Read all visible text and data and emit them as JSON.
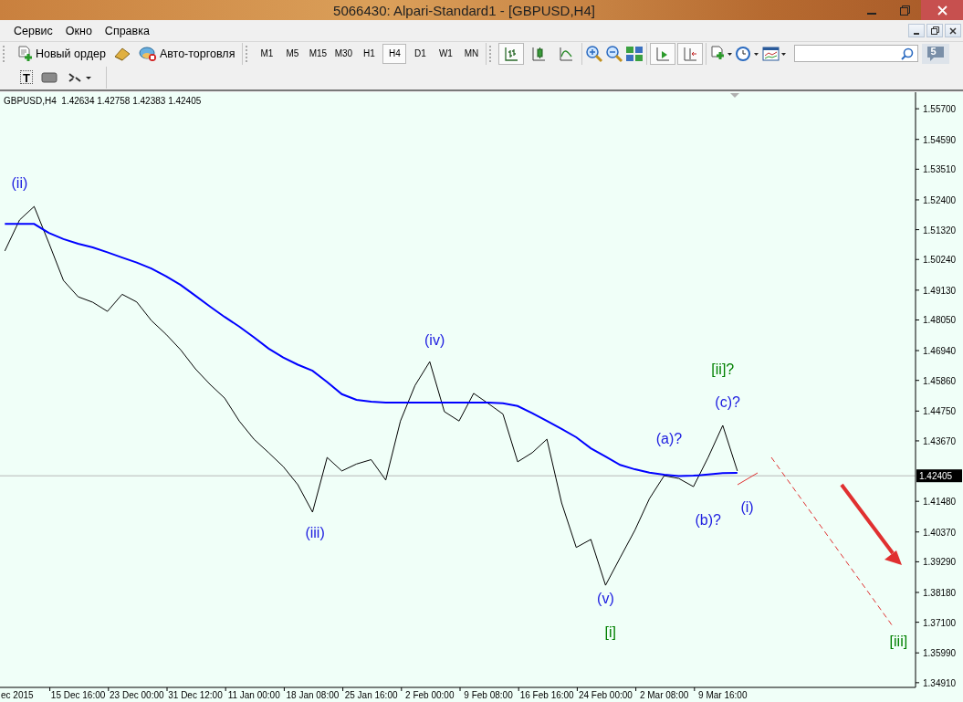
{
  "window": {
    "title": "5066430: Alpari-Standard1 - [GBPUSD,H4]"
  },
  "menu": [
    {
      "label": "Сервис"
    },
    {
      "label": "Окно"
    },
    {
      "label": "Справка"
    }
  ],
  "toolbar": {
    "order_button": "Новый ордер",
    "autotrade_button": "Авто-торговля",
    "timeframes": [
      {
        "label": "M1",
        "selected": false
      },
      {
        "label": "M5",
        "selected": false
      },
      {
        "label": "M15",
        "selected": false
      },
      {
        "label": "M30",
        "selected": false
      },
      {
        "label": "H1",
        "selected": false
      },
      {
        "label": "H4",
        "selected": true
      },
      {
        "label": "D1",
        "selected": false
      },
      {
        "label": "W1",
        "selected": false
      },
      {
        "label": "MN",
        "selected": false
      }
    ],
    "chart_types": [
      {
        "kind": "bars",
        "selected": true
      },
      {
        "kind": "candles",
        "selected": false
      },
      {
        "kind": "line",
        "selected": false
      }
    ],
    "scroll_tools": [
      {
        "kind": "autoscroll",
        "selected": true
      },
      {
        "kind": "shift",
        "selected": true
      }
    ],
    "notification_count": "5"
  },
  "drawing_toolbar": {
    "text_label_tool": "T"
  },
  "chart": {
    "header": "GBPUSD,H4  1.42634 1.42758 1.42383 1.42405",
    "current_price": "1.42405",
    "cut_time_label": "ec 2015",
    "chart_data": {
      "type": "line",
      "categories": [
        null,
        null,
        null,
        null,
        null,
        "15 Dec 16:00",
        null,
        null,
        null,
        "23 Dec 00:00",
        null,
        null,
        null,
        "31 Dec 12:00",
        null,
        null,
        null,
        "11 Jan 00:00",
        null,
        null,
        null,
        "18 Jan 08:00",
        null,
        null,
        null,
        "25 Jan 16:00",
        null,
        null,
        null,
        "2 Feb 00:00",
        null,
        null,
        null,
        "9 Feb 08:00",
        null,
        null,
        null,
        "16 Feb 16:00",
        null,
        null,
        null,
        "24 Feb 00:00",
        null,
        null,
        null,
        "2 Mar 08:00",
        null,
        null,
        null,
        "9 Mar 16:00",
        null
      ],
      "ref_lines": [
        {
          "axis": "y",
          "value": 1.42405,
          "color": "#b8b8b8"
        }
      ],
      "series": [
        {
          "color": "#000000",
          "values": [
            1.5055,
            1.5167,
            1.5216,
            1.5084,
            1.4948,
            1.4889,
            1.4869,
            1.4836,
            1.4898,
            1.487,
            1.4803,
            1.4753,
            1.4697,
            1.4628,
            1.4572,
            1.4522,
            1.4439,
            1.4373,
            1.4324,
            1.4274,
            1.4208,
            1.4109,
            1.4307,
            1.4258,
            1.4283,
            1.4299,
            1.4225,
            1.4439,
            1.4568,
            1.4654,
            1.4473,
            1.4439,
            1.4539,
            1.4502,
            1.4464,
            1.4291,
            1.4324,
            1.4373,
            1.4142,
            1.3981,
            1.401,
            1.3844,
            1.3944,
            1.4043,
            1.4158,
            1.4241,
            1.4231,
            1.4201,
            1.4307,
            1.4423,
            1.4258
          ]
        },
        {
          "color": "#0000ff",
          "values": [
            1.5153,
            1.5153,
            1.5153,
            1.512,
            1.5098,
            1.5081,
            1.5068,
            1.505,
            1.5031,
            1.5013,
            1.4991,
            1.4963,
            1.4932,
            1.4893,
            1.4854,
            1.4816,
            1.4781,
            1.4742,
            1.4701,
            1.4669,
            1.4643,
            1.4621,
            1.458,
            1.4536,
            1.4516,
            1.4509,
            1.4506,
            1.4506,
            1.4506,
            1.4506,
            1.4506,
            1.4506,
            1.4506,
            1.4506,
            1.4503,
            1.4493,
            1.4467,
            1.4439,
            1.441,
            1.438,
            1.434,
            1.431,
            1.428,
            1.4264,
            1.4252,
            1.4244,
            1.424,
            1.4241,
            1.4245,
            1.425,
            1.4251
          ]
        }
      ],
      "ylim": [
        1.3474,
        1.563
      ],
      "yticks": [
        {
          "value": 1.557,
          "label": "1.55700"
        },
        {
          "value": 1.5459,
          "label": "1.54590"
        },
        {
          "value": 1.5351,
          "label": "1.53510"
        },
        {
          "value": 1.524,
          "label": "1.52400"
        },
        {
          "value": 1.5132,
          "label": "1.51320"
        },
        {
          "value": 1.5024,
          "label": "1.50240"
        },
        {
          "value": 1.4913,
          "label": "1.49130"
        },
        {
          "value": 1.4805,
          "label": "1.48050"
        },
        {
          "value": 1.4694,
          "label": "1.46940"
        },
        {
          "value": 1.4586,
          "label": "1.45860"
        },
        {
          "value": 1.4475,
          "label": "1.44750"
        },
        {
          "value": 1.4367,
          "label": "1.43670"
        },
        {
          "value": 1.4148,
          "label": "1.41480"
        },
        {
          "value": 1.4037,
          "label": "1.40370"
        },
        {
          "value": 1.3929,
          "label": "1.39290"
        },
        {
          "value": 1.3818,
          "label": "1.38180"
        },
        {
          "value": 1.371,
          "label": "1.37100"
        },
        {
          "value": 1.3599,
          "label": "1.35990"
        },
        {
          "value": 1.3491,
          "label": "1.34910"
        }
      ]
    },
    "wave_labels": [
      {
        "text": "(ii)",
        "color": "#2020e0"
      },
      {
        "text": "(iii)",
        "color": "#2020e0"
      },
      {
        "text": "(iv)",
        "color": "#2020e0"
      },
      {
        "text": "(v)",
        "color": "#2020e0"
      },
      {
        "text": "[i]",
        "color": "#008000"
      },
      {
        "text": "(a)?",
        "color": "#2020e0"
      },
      {
        "text": "(b)?",
        "color": "#2020e0"
      },
      {
        "text": "(c)?",
        "color": "#2020e0"
      },
      {
        "text": "[ii]?",
        "color": "#008000"
      },
      {
        "text": "(i)",
        "color": "#2020e0"
      },
      {
        "text": "[iii]",
        "color": "#008000"
      }
    ]
  }
}
